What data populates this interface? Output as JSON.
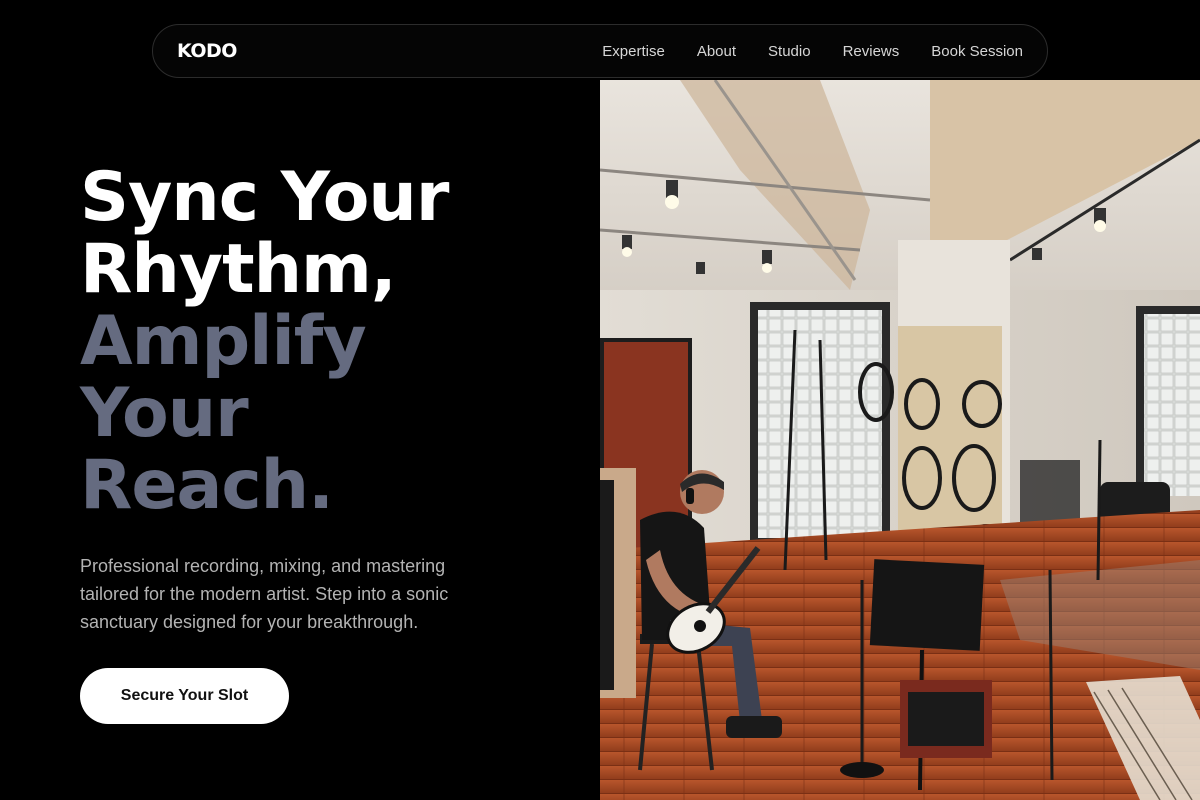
{
  "nav": {
    "logo": "KODO",
    "links": [
      "Expertise",
      "About",
      "Studio",
      "Reviews",
      "Book Session"
    ]
  },
  "hero": {
    "headline_light": [
      "Sync Your",
      "Rhythm,"
    ],
    "headline_muted": [
      "Amplify",
      "Your",
      "Reach."
    ],
    "subtext": "Professional recording, mixing, and mastering tailored for the modern artist. Step into a sonic sanctuary designed for your breakthrough.",
    "cta_label": "Secure Your Slot"
  },
  "image": {
    "alt": "Musician playing guitar in recording studio"
  },
  "colors": {
    "background": "#000000",
    "headline_light": "#ffffff",
    "headline_muted": "#656b80",
    "subtext": "#b3b3b3",
    "cta_bg": "#ffffff",
    "cta_text": "#111111"
  }
}
